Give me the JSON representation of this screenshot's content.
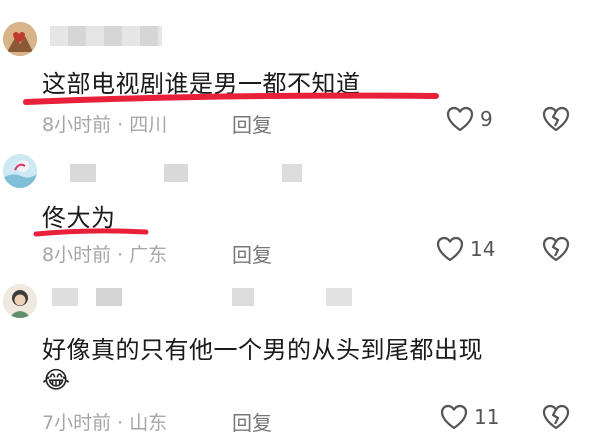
{
  "comments": [
    {
      "text": "这部电视剧谁是男一都不知道",
      "time": "8小时前",
      "location": "四川",
      "reply_label": "回复",
      "likes": "9"
    },
    {
      "text": "佟大为",
      "time": "8小时前",
      "location": "广东",
      "reply_label": "回复",
      "likes": "14"
    },
    {
      "text": "好像真的只有他一个男的从头到尾都出现",
      "emoji": "😂",
      "time": "7小时前",
      "location": "山东",
      "reply_label": "回复",
      "likes": "11"
    }
  ],
  "meta_separator": "·",
  "colors": {
    "underline": "#e8203a",
    "meta_text": "#a6a6a6"
  },
  "icons": [
    "heart-outline-icon",
    "broken-heart-dislike-icon"
  ]
}
